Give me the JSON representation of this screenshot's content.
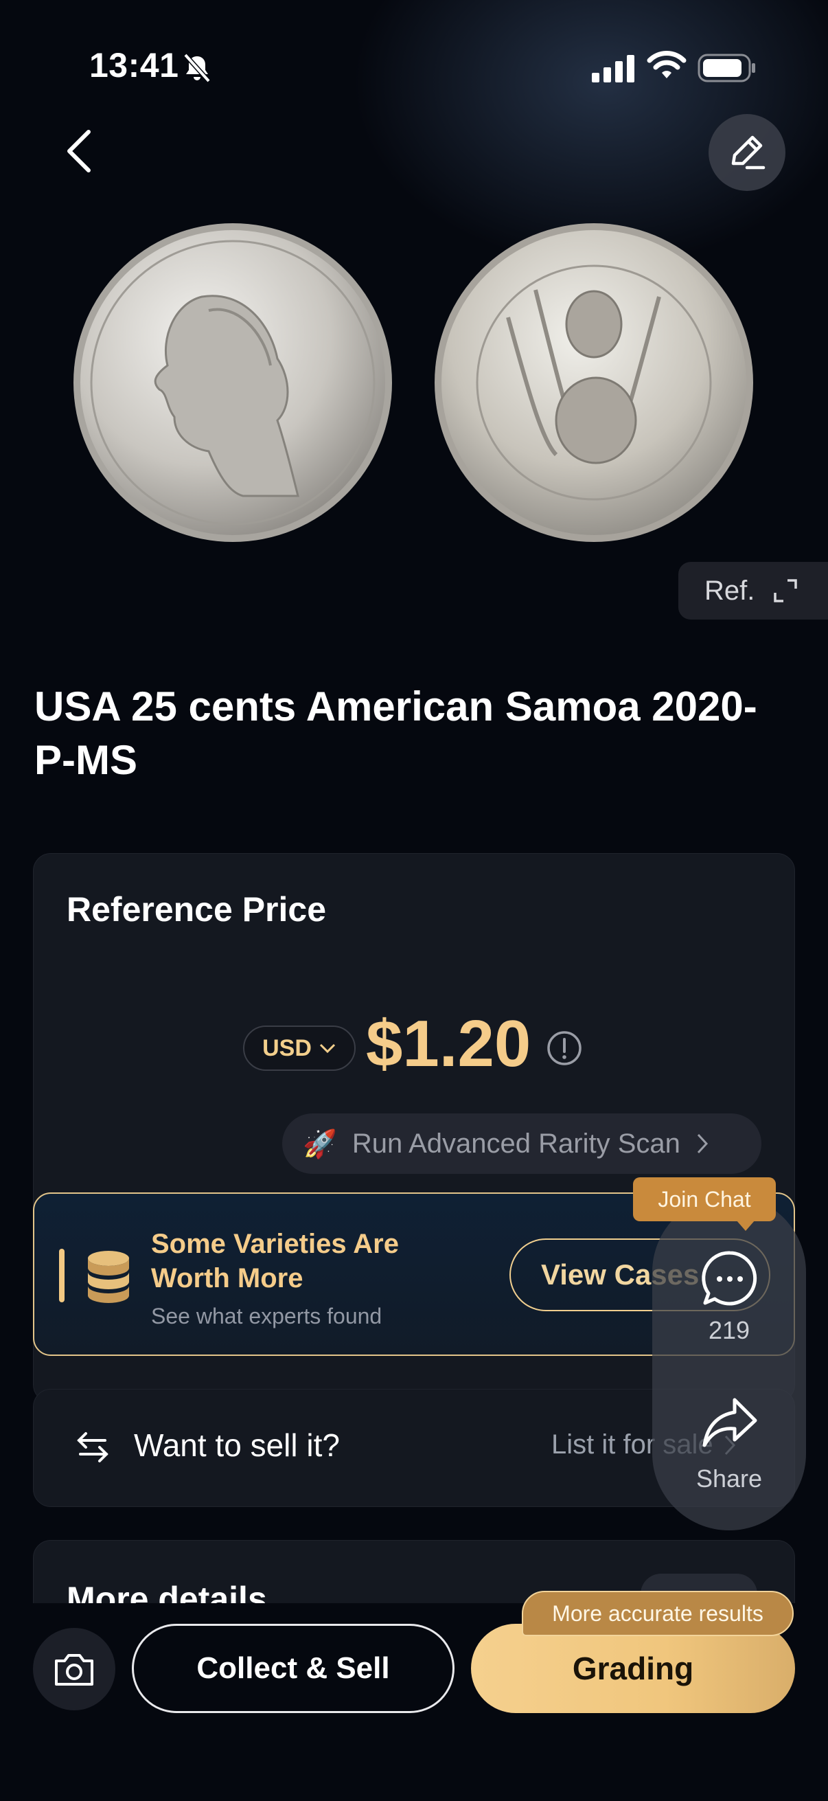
{
  "status_bar": {
    "time": "13:41"
  },
  "reference_button": {
    "label": "Ref."
  },
  "coin": {
    "title": "USA 25 cents  American Samoa 2020-P-MS"
  },
  "reference_price": {
    "title": "Reference Price",
    "currency": "USD",
    "value": "$1.20",
    "rarity_scan_label": "Run Advanced Rarity Scan",
    "rarity_scan_emoji": "🚀"
  },
  "varieties": {
    "title": "Some Varieties Are Worth More",
    "subtitle": "See what experts found",
    "button_label": "View Cases"
  },
  "sell": {
    "label": "Want to sell it?",
    "link": "List it for sale"
  },
  "details": {
    "title": "More details"
  },
  "floating": {
    "join_chat": "Join Chat",
    "chat_count": "219",
    "share_label": "Share"
  },
  "bottom_bar": {
    "collect_label": "Collect & Sell",
    "grading_label": "Grading",
    "accuracy_badge": "More accurate results"
  },
  "colors": {
    "accent_gold": "#f5cc8a",
    "background": "#05080f",
    "card": "#141820",
    "badge_orange": "#c98a3c"
  },
  "icons": [
    "bell-slash-icon",
    "signal-icon",
    "wifi-icon",
    "battery-icon",
    "back-icon",
    "edit-icon",
    "info-icon",
    "expand-icon",
    "chevron-right-icon",
    "coins-stack-icon",
    "swap-icon",
    "camera-icon",
    "chat-icon",
    "share-icon"
  ]
}
